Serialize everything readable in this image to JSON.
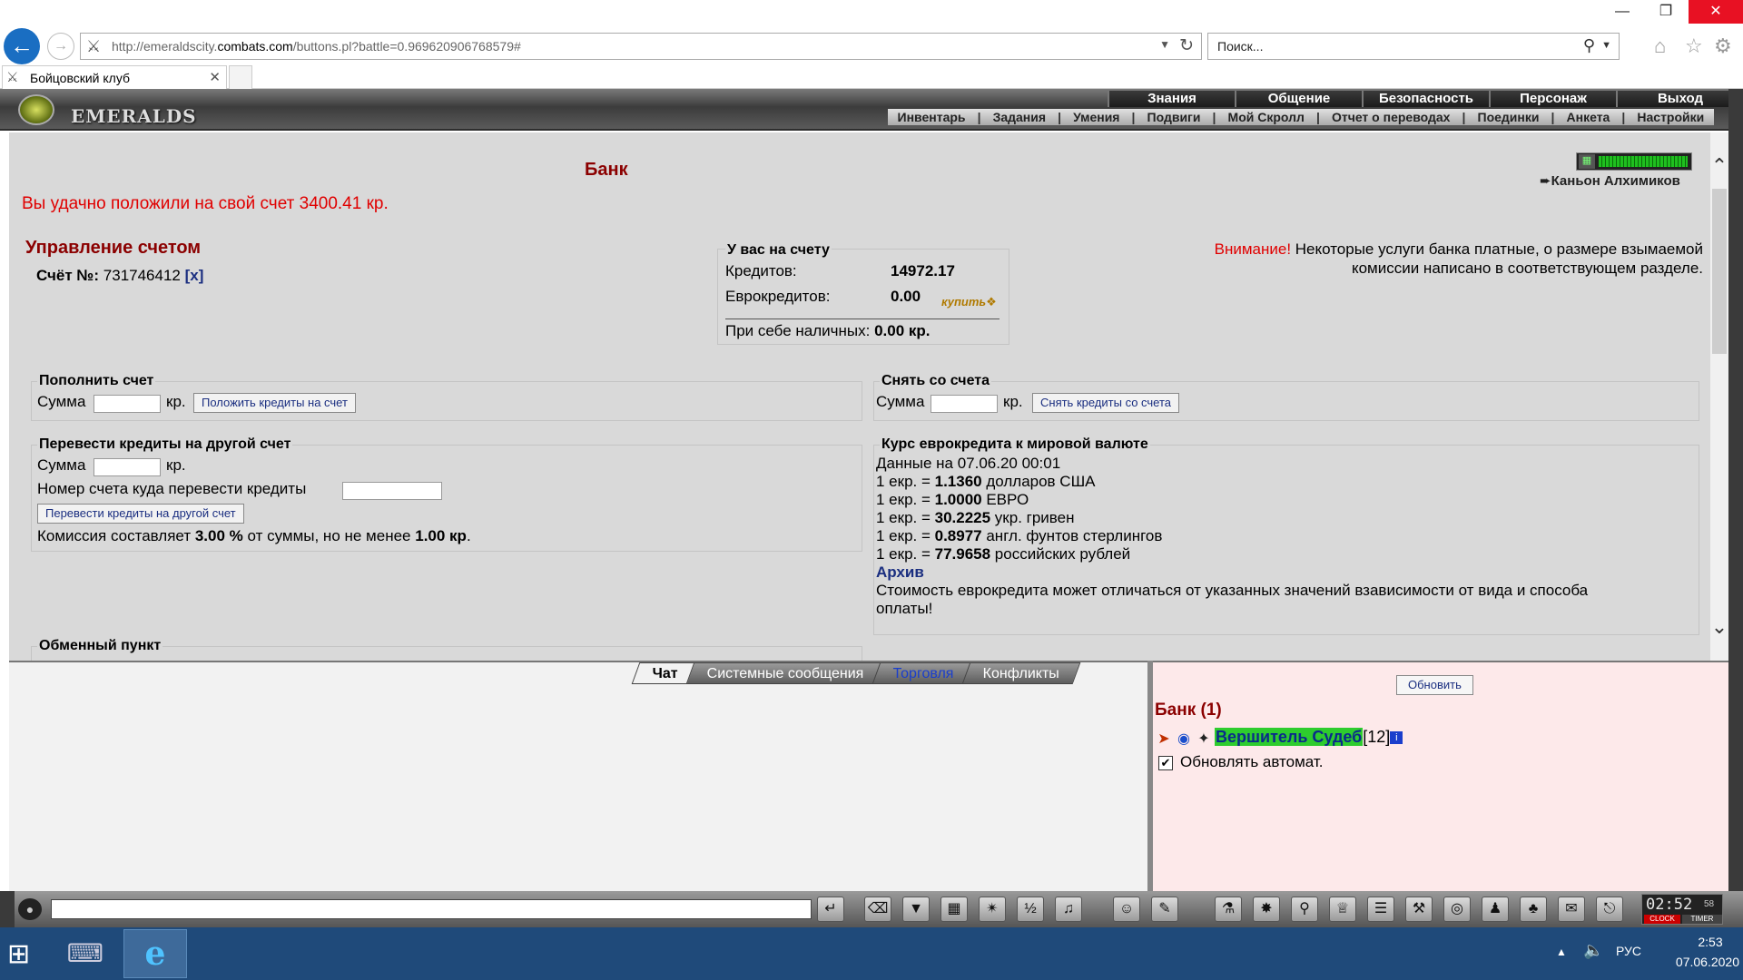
{
  "browser": {
    "url_prefix": "http://emeraldscity.",
    "url_host": "combats.com",
    "url_path": "/buttons.pl?battle=0.969620906768579#",
    "search_placeholder": "Поиск...",
    "tab_title": "Бойцовский клуб"
  },
  "header": {
    "logo_text": "EMERALDS",
    "top_menu": [
      "Знания",
      "Общение",
      "Безопасность",
      "Персонаж",
      "Выход"
    ],
    "sub_menu": [
      "Инвентарь",
      "Задания",
      "Умения",
      "Подвиги",
      "Мой Скролл",
      "Отчет о переводах",
      "Поединки",
      "Анкета",
      "Настройки"
    ]
  },
  "bank": {
    "title": "Банк",
    "success_message": "Вы удачно положили на свой счет 3400.41 кр.",
    "location": "Каньон Алхимиков",
    "account_heading": "Управление счетом",
    "account_label": "Счёт №:",
    "account_number": "731746412",
    "account_close": "[x]",
    "balance": {
      "heading": "У вас на счету",
      "credits_label": "Кредитов:",
      "credits_value": "14972.17",
      "eurocredits_label": "Еврокредитов:",
      "eurocredits_value": "0.00",
      "buy_label": "купить",
      "cash_label": "При себе наличных:",
      "cash_value": "0.00 кр."
    },
    "notice": {
      "warning": "Внимание!",
      "text": " Некоторые услуги банка платные, о размере взымаемой комиссии написано в соответствующем разделе."
    },
    "deposit": {
      "title": "Пополнить счет",
      "sum_label": "Сумма",
      "unit": "кр.",
      "button": "Положить кредиты на счет"
    },
    "withdraw": {
      "title": "Снять со счета",
      "sum_label": "Сумма",
      "unit": "кр.",
      "button": "Снять кредиты со счета"
    },
    "transfer": {
      "title": "Перевести кредиты на другой счет",
      "sum_label": "Сумма",
      "unit": "кр.",
      "target_label": "Номер счета куда перевести кредиты",
      "button": "Перевести кредиты на другой счет",
      "commission_pre": "Комиссия составляет ",
      "commission_pct": "3.00 %",
      "commission_mid": " от суммы, но не менее ",
      "commission_min": "1.00 кр",
      "commission_post": "."
    },
    "rates": {
      "title": "Курс еврокредита к мировой валюте",
      "date_line": "Данные на 07.06.20 00:01",
      "prefix": "1 екр. = ",
      "rows": [
        {
          "value": "1.1360",
          "currency": " долларов США"
        },
        {
          "value": "1.0000",
          "currency": " ЕВРО"
        },
        {
          "value": "30.2225",
          "currency": " укр. гривен"
        },
        {
          "value": "0.8977",
          "currency": " англ. фунтов стерлингов"
        },
        {
          "value": "77.9658",
          "currency": " российских рублей"
        }
      ],
      "archive": "Архив",
      "disclaimer_1": "Стоимость еврокредита может отличаться от указанных значений взависимости от вида и способа",
      "disclaimer_2": "оплаты!"
    },
    "exchange_title": "Обменный пункт"
  },
  "chat": {
    "tabs": [
      "Чат",
      "Системные сообщения",
      "Торговля",
      "Конфликты"
    ]
  },
  "side": {
    "refresh_button": "Обновить",
    "room_title": "Банк (1)",
    "user_name": "Вершитель Судеб",
    "user_level": "[12]",
    "user_info": "i",
    "auto_refresh_label": "Обновлять автомат."
  },
  "toolbar": {
    "clock_time": "02:52",
    "clock_seconds": "58",
    "clock_label": "CLOCK",
    "timer_label": "TIMER"
  },
  "taskbar": {
    "lang": "РУС",
    "time": "2:53",
    "date": "07.06.2020"
  }
}
